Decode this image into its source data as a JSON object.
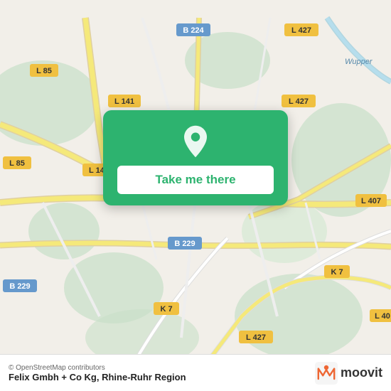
{
  "map": {
    "attribution": "© OpenStreetMap contributors",
    "place_name": "Felix Gmbh + Co Kg, Rhine-Ruhr Region"
  },
  "button_card": {
    "label": "Take me there",
    "pin_icon": "location-pin"
  },
  "moovit": {
    "logo_text": "moovit"
  },
  "road_labels": [
    {
      "id": "b224",
      "text": "B 224"
    },
    {
      "id": "l427_top",
      "text": "L 427"
    },
    {
      "id": "l85_top",
      "text": "L 85"
    },
    {
      "id": "l85_left",
      "text": "L 85"
    },
    {
      "id": "l141_top",
      "text": "L 141"
    },
    {
      "id": "l141_mid",
      "text": "L 141"
    },
    {
      "id": "l427_mid",
      "text": "L 427"
    },
    {
      "id": "b229_mid",
      "text": "B 229"
    },
    {
      "id": "k7_mid",
      "text": "K 7"
    },
    {
      "id": "k7_right",
      "text": "K 7"
    },
    {
      "id": "b229_left",
      "text": "B 229"
    },
    {
      "id": "l427_bot",
      "text": "L 427"
    },
    {
      "id": "l407",
      "text": "L 407"
    },
    {
      "id": "l40",
      "text": "L 40"
    },
    {
      "id": "wupper",
      "text": "Wupper"
    }
  ],
  "colors": {
    "map_bg": "#f2efe9",
    "green_area": "#c8dfc8",
    "road_yellow": "#f5e97a",
    "road_white": "#ffffff",
    "road_outline": "#ccbbaa",
    "water": "#aad3df",
    "button_green": "#2db36f",
    "label_bg_yellow": "#f0c040",
    "label_bg_blue": "#6699cc"
  }
}
